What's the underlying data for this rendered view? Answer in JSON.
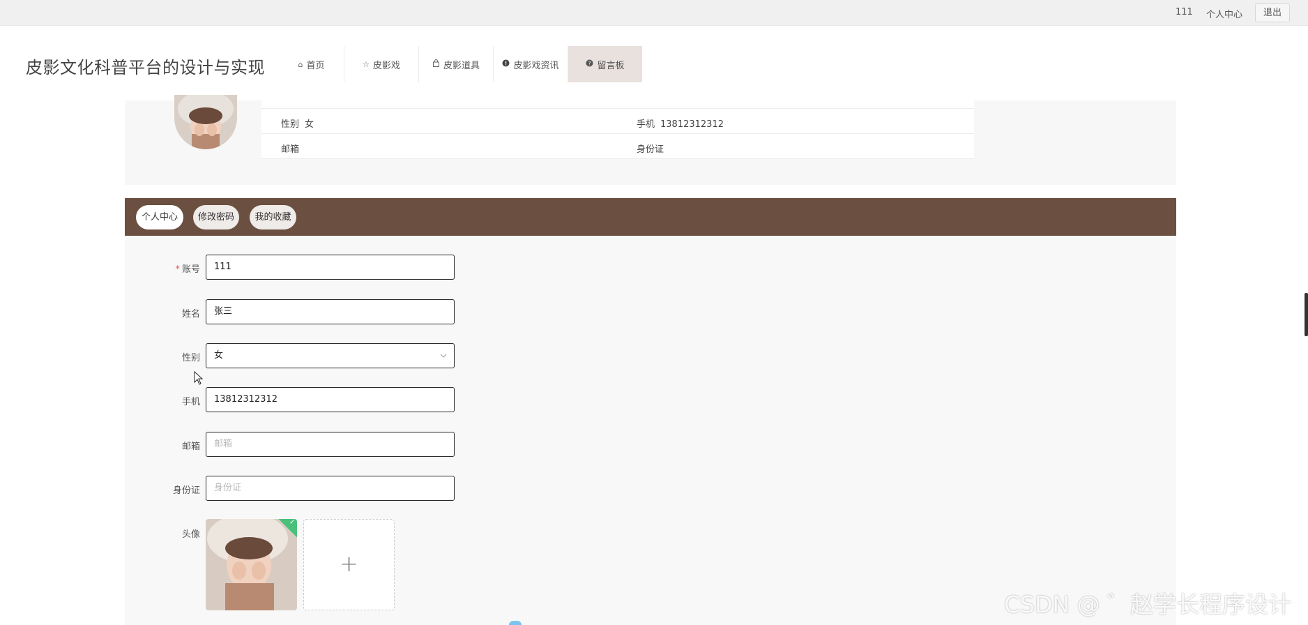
{
  "topbar": {
    "username": "111",
    "center_link": "个人中心",
    "logout": "退出"
  },
  "site": {
    "title": "皮影文化科普平台的设计与实现"
  },
  "nav": {
    "items": [
      {
        "label": "首页",
        "icon": "home-icon"
      },
      {
        "label": "皮影戏",
        "icon": "star-icon"
      },
      {
        "label": "皮影道具",
        "icon": "bag-icon"
      },
      {
        "label": "皮影戏资讯",
        "icon": "info-circle-icon"
      },
      {
        "label": "留言板",
        "icon": "question-circle-icon",
        "active": true
      }
    ]
  },
  "profile_summary": {
    "rows": [
      {
        "left_label": "性别",
        "left_value": "女",
        "right_label": "手机",
        "right_value": "13812312312"
      },
      {
        "left_label": "邮箱",
        "left_value": "",
        "right_label": "身份证",
        "right_value": ""
      }
    ]
  },
  "tabs": {
    "items": [
      {
        "label": "个人中心",
        "active": true
      },
      {
        "label": "修改密码",
        "active": false
      },
      {
        "label": "我的收藏",
        "active": false
      }
    ]
  },
  "form": {
    "account": {
      "label": "账号",
      "required_mark": "*",
      "value": "111"
    },
    "name": {
      "label": "姓名",
      "value": "张三"
    },
    "gender": {
      "label": "性别",
      "value": "女"
    },
    "phone": {
      "label": "手机",
      "value": "13812312312"
    },
    "email": {
      "label": "邮箱",
      "placeholder": "邮箱"
    },
    "idcard": {
      "label": "身份证",
      "placeholder": "身份证"
    },
    "avatar": {
      "label": "头像",
      "add_symbol": "+"
    }
  },
  "watermark": "CSDN @ ゛赵学长程序设计",
  "colors": {
    "tab_bar": "#6b4f40",
    "nav_active": "#e8e1de",
    "upload_success": "#49c17a"
  }
}
